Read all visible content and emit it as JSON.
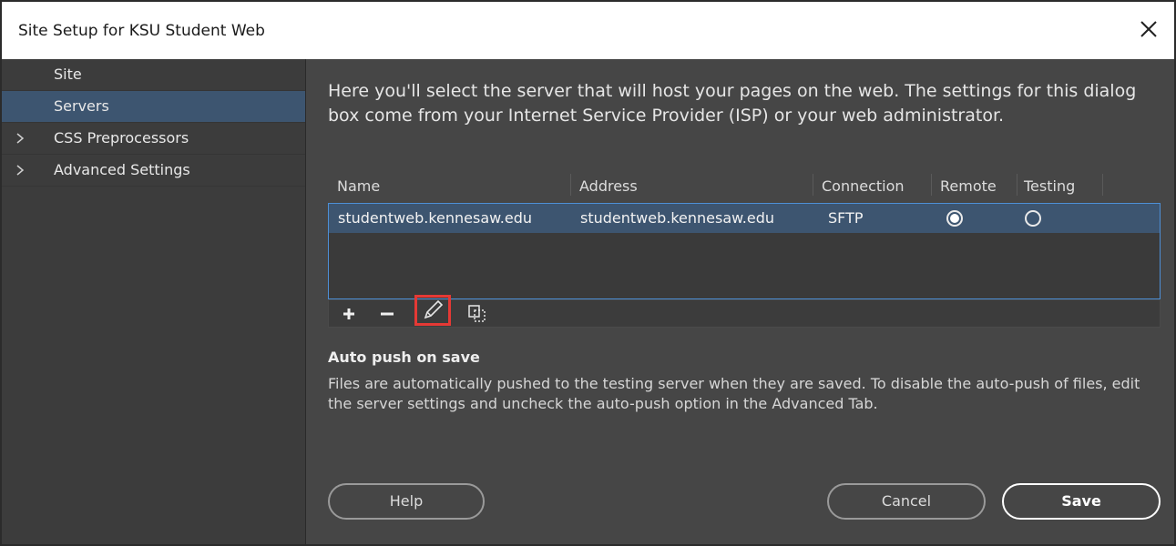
{
  "window": {
    "title": "Site Setup for KSU Student Web"
  },
  "sidebar": {
    "items": [
      {
        "label": "Site",
        "selected": false,
        "expandable": false
      },
      {
        "label": "Servers",
        "selected": true,
        "expandable": false
      },
      {
        "label": "CSS Preprocessors",
        "selected": false,
        "expandable": true
      },
      {
        "label": "Advanced Settings",
        "selected": false,
        "expandable": true
      }
    ]
  },
  "main": {
    "intro": "Here you'll select the server that will host your pages on the web. The settings for this dialog box come from your Internet Service Provider (ISP) or your web administrator.",
    "table": {
      "headers": [
        "Name",
        "Address",
        "Connection",
        "Remote",
        "Testing"
      ],
      "rows": [
        {
          "name": "studentweb.kennesaw.edu",
          "address": "studentweb.kennesaw.edu",
          "connection": "SFTP",
          "remote": true,
          "testing": false
        }
      ]
    },
    "toolbar": {
      "add_icon": "plus-icon",
      "remove_icon": "minus-icon",
      "edit_icon": "pencil-icon",
      "duplicate_icon": "duplicate-icon"
    },
    "auto_push_title": "Auto push on save",
    "auto_push_desc": "Files are automatically pushed to the testing server when they are saved. To disable the auto-push of files, edit the server settings and uncheck the auto-push option in the Advanced Tab."
  },
  "buttons": {
    "help": "Help",
    "cancel": "Cancel",
    "save": "Save"
  },
  "colors": {
    "selection": "#3d5570",
    "accent_border": "#4d8fd6",
    "highlight_box": "#e53935",
    "panel_bg": "#464646"
  }
}
